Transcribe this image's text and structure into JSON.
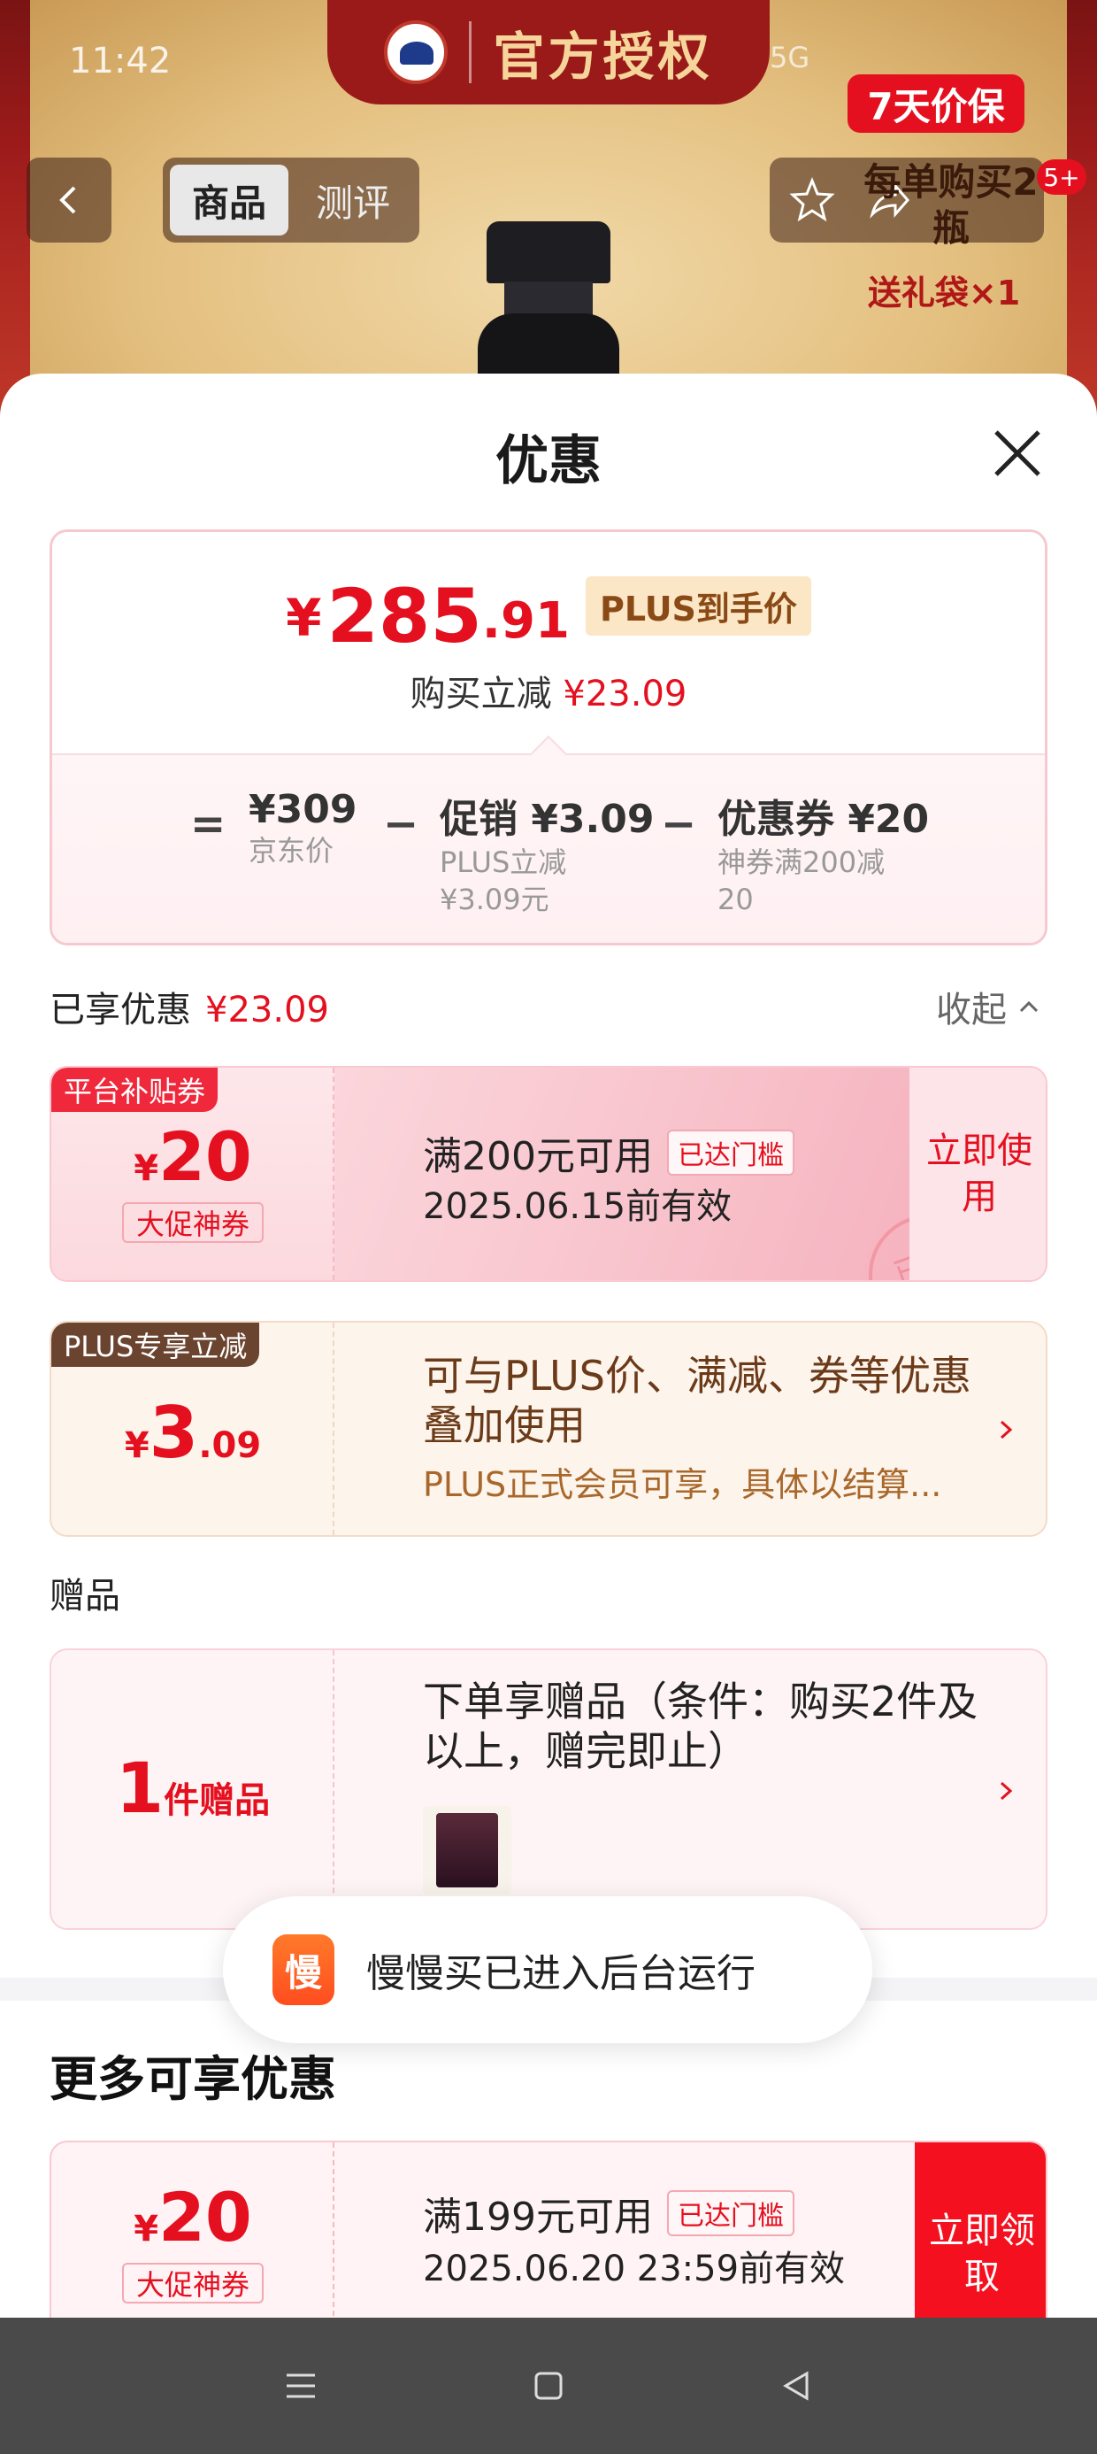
{
  "status": {
    "time": "11:42",
    "right": "5G"
  },
  "header": {
    "banner_text": "官方授权",
    "tabs": [
      {
        "label": "商品"
      },
      {
        "label": "测评"
      }
    ],
    "badge": "5+",
    "promo_tag": "7天价保",
    "promo_text": "每单购买2瓶",
    "promo_gift": "送礼袋×1"
  },
  "sheet": {
    "title": "优惠",
    "price": {
      "currency": "¥",
      "integer": "285",
      "decimal": ".91",
      "tag": "PLUS到手价"
    },
    "save": {
      "label": "购买立减",
      "amount": "¥23.09"
    },
    "breakdown": {
      "eq": "=",
      "jd": {
        "value": "¥309",
        "label": "京东价"
      },
      "minus1": "−",
      "promo": {
        "value": "促销 ¥3.09",
        "label1": "PLUS立减",
        "label2": "¥3.09元"
      },
      "minus2": "−",
      "coupon": {
        "value": "优惠券 ¥20",
        "label1": "神券满200减",
        "label2": "20"
      }
    },
    "enjoyed": {
      "label": "已享优惠",
      "amount": "¥23.09",
      "collapse": "收起"
    },
    "coupon1": {
      "corner": "平台补贴券",
      "currency": "¥",
      "amount": "20",
      "type": "大促神券",
      "condition": "满200元可用",
      "reached": "已达门槛",
      "validity": "2025.06.15前有效",
      "action": "立即使用",
      "stamp": "已领"
    },
    "plus": {
      "corner": "PLUS专享立减",
      "currency": "¥",
      "amount": "3",
      "decimal": ".09",
      "desc": "可与PLUS价、满减、券等优惠叠加使用",
      "sub": "PLUS正式会员可享，具体以结算..."
    },
    "gift": {
      "section_title": "赠品",
      "count": "1",
      "unit": "件赠品",
      "desc": "下单享赠品（条件：购买2件及以上，赠完即止）"
    },
    "toast": {
      "icon_text": "慢",
      "text": "慢慢买已进入后台运行"
    },
    "more": {
      "title": "更多可享优惠",
      "coupon": {
        "currency": "¥",
        "amount": "20",
        "type": "大促神券",
        "condition": "满199元可用",
        "reached": "已达门槛",
        "validity": "2025.06.20 23:59前有效",
        "action": "立即领取"
      }
    }
  }
}
